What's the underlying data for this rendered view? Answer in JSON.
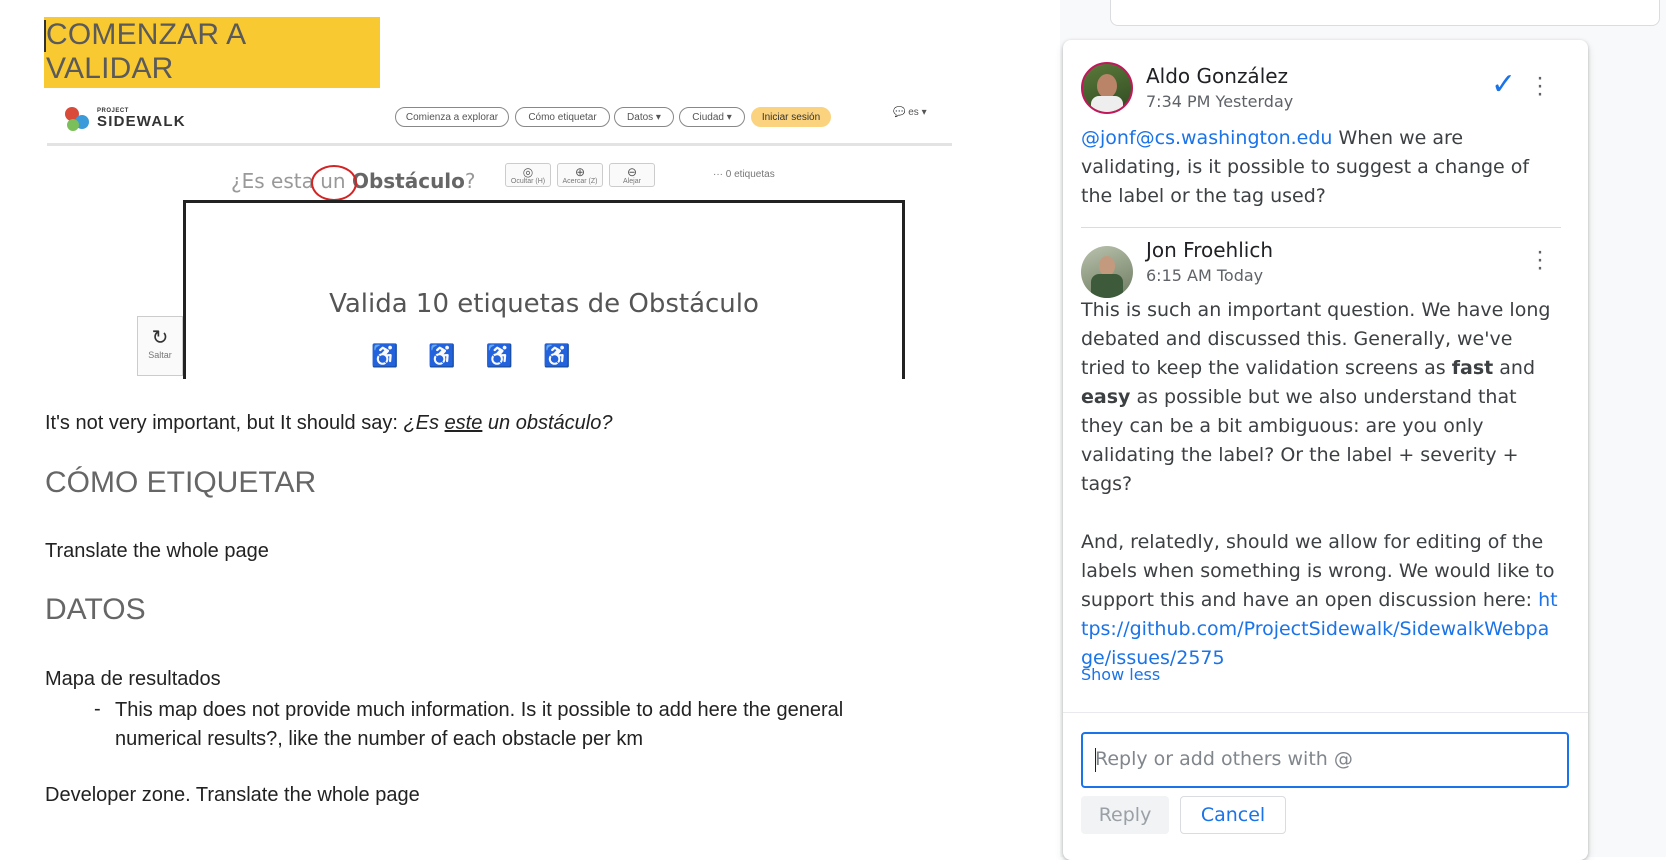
{
  "doc": {
    "heading1": "COMENZAR A VALIDAR",
    "screenshot": {
      "logo_small": "PROJECT",
      "logo_big": "SIDEWALK",
      "nav": [
        "Comienza a explorar",
        "Cómo etiquetar",
        "Datos ▾",
        "Ciudad ▾",
        "Iniciar sesión"
      ],
      "lang": "es ▾",
      "question_pre": "¿Es ",
      "question_mid": "esta",
      "question_post": " un ",
      "question_bold": "Obstáculo",
      "question_end": "?",
      "tools": [
        {
          "icon": "◎",
          "label": "Ocultar (H)"
        },
        {
          "icon": "⊕",
          "label": "Acercar (Z)"
        },
        {
          "icon": "⊖",
          "label": "Alejar"
        }
      ],
      "labels_count": "··· 0 etiquetas",
      "mission": "Valida 10 etiquetas de Obstáculo",
      "skip_label": "Saltar"
    },
    "p1_pre": "It's not very important, but It should say: ",
    "p1_italic_a": "¿Es ",
    "p1_underline": "este",
    "p1_italic_b": " un obstáculo?",
    "heading2": "CÓMO ETIQUETAR",
    "p2": "Translate the whole page",
    "heading3": "DATOS",
    "p3": "Mapa de resultados",
    "bullet_dash": "-",
    "bullet": "This map does not provide much information. Is it possible to add here the general numerical results?, like the number of each obstacle per km",
    "p4": "Developer zone. Translate the whole page"
  },
  "comments": {
    "c1": {
      "author": "Aldo González",
      "time": "7:34 PM Yesterday",
      "mention": "@jonf@cs.washington.edu",
      "text": " When we are validating, is it possible to suggest a change of the label or the tag used?"
    },
    "c2": {
      "author": "Jon Froehlich",
      "time": "6:15 AM Today",
      "text_a": "This is such an important question. We have long debated and discussed this. Generally, we've tried to keep the validation screens as ",
      "bold_a": "fast",
      "text_b": " and ",
      "bold_b": "easy",
      "text_c": " as possible but we also understand that they can be a bit ambiguous: are you only validating the label? Or the label + severity + tags?",
      "text_d": "And, relatedly, should we allow for editing of the labels when something is wrong. We would like to support this and have an open discussion here: ",
      "link": "https://github.com/ProjectSidewalk/SidewalkWebpage/issues/2575"
    },
    "show_less": "Show less",
    "reply_placeholder": "Reply or add others with @",
    "reply_button": "Reply",
    "cancel_button": "Cancel"
  },
  "colors": {
    "highlight": "#f9c932",
    "accent": "#1a73e8",
    "annotation_circle": "#d32424"
  }
}
